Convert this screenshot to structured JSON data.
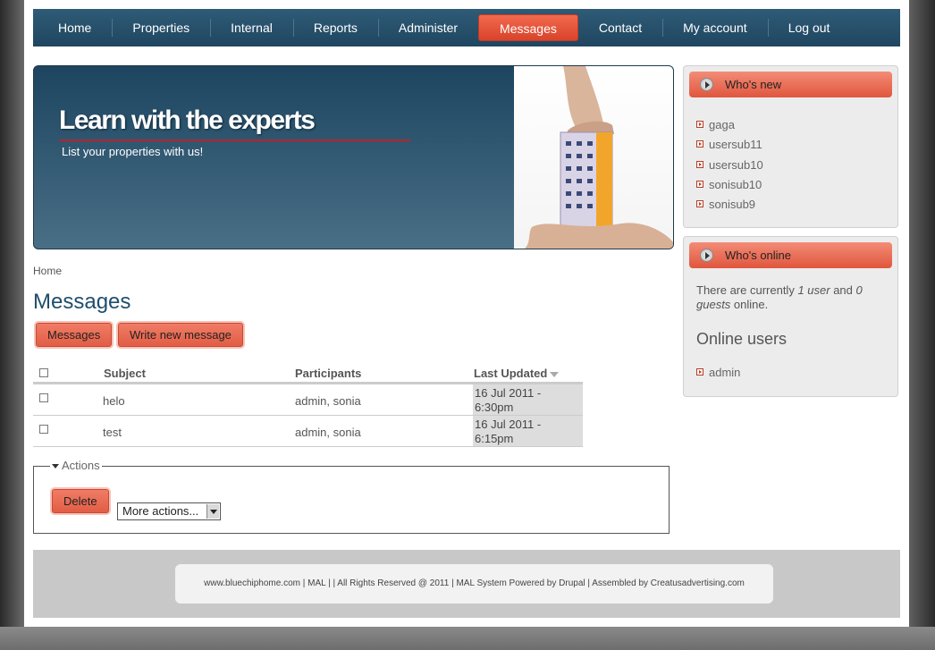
{
  "nav": {
    "items": [
      {
        "label": "Home",
        "active": false
      },
      {
        "label": "Properties",
        "active": false
      },
      {
        "label": "Internal",
        "active": false
      },
      {
        "label": "Reports",
        "active": false
      },
      {
        "label": "Administer",
        "active": false
      },
      {
        "label": "Messages",
        "active": true
      },
      {
        "label": "Contact",
        "active": false
      },
      {
        "label": "My account",
        "active": false
      },
      {
        "label": "Log out",
        "active": false
      }
    ]
  },
  "banner": {
    "title": "Learn with the experts",
    "subtitle": "List your properties with us!"
  },
  "breadcrumb": "Home",
  "page_title": "Messages",
  "buttons": {
    "messages": "Messages",
    "write_new": "Write new message",
    "delete": "Delete"
  },
  "table": {
    "headers": {
      "subject": "Subject",
      "participants": "Participants",
      "last_updated": "Last Updated"
    },
    "rows": [
      {
        "subject": "helo",
        "participants": "admin, sonia",
        "updated_line1": "16 Jul 2011 -",
        "updated_line2": "6:30pm"
      },
      {
        "subject": "test",
        "participants": "admin, sonia",
        "updated_line1": "16 Jul 2011 -",
        "updated_line2": "6:15pm"
      }
    ]
  },
  "actions": {
    "legend": "Actions",
    "select_value": "More actions..."
  },
  "whos_new": {
    "title": "Who's new",
    "users": [
      "gaga",
      "usersub11",
      "usersub10",
      "sonisub10",
      "sonisub9"
    ]
  },
  "whos_online": {
    "title": "Who's online",
    "text_prefix": "There are currently ",
    "user_count": "1 user",
    "text_mid": " and ",
    "guest_count": "0 guests",
    "text_suffix": " online.",
    "online_title": "Online users",
    "users": [
      "admin"
    ]
  },
  "footer": {
    "text": "www.bluechiphome.com | MAL | | All Rights Reserved @ 2011 | MAL System Powered by Drupal | Assembled by Creatusadvertising.com"
  },
  "colors": {
    "accent": "#e25d45",
    "nav_bg": "#1f4660",
    "title": "#1f4e6b"
  }
}
